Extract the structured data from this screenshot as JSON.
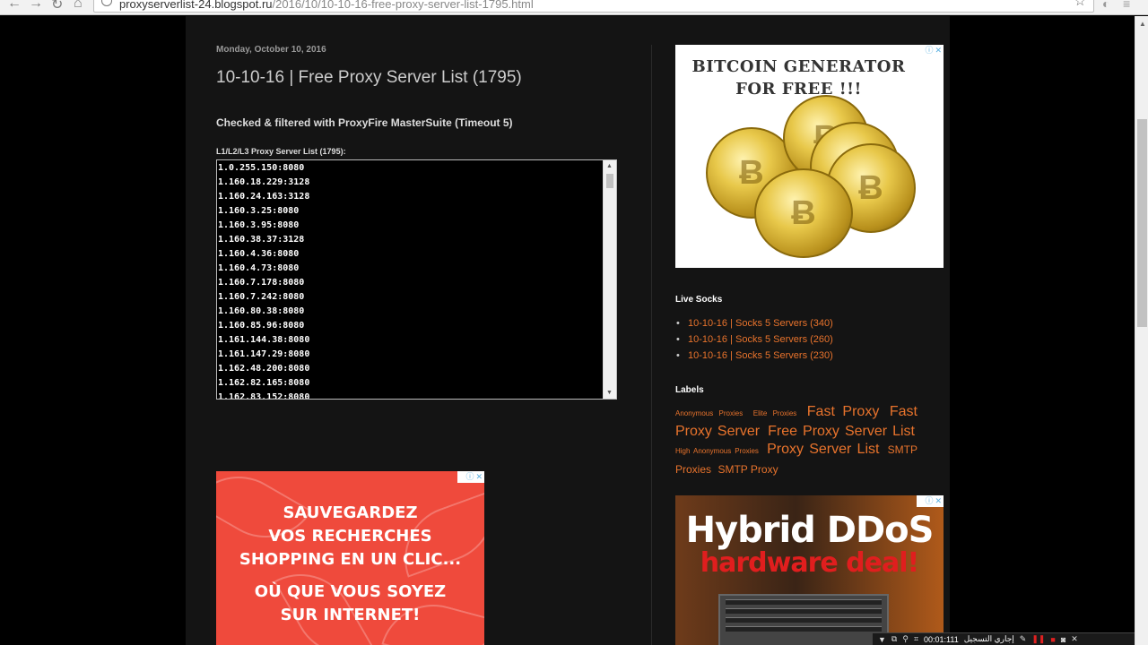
{
  "browser": {
    "url_host": "proxyserverlist-24.blogspot.ru",
    "url_path": "/2016/10/10-10-16-free-proxy-server-list-1795.html",
    "back_icon": "arrow-left-icon",
    "forward_icon": "arrow-right-icon",
    "reload_icon": "reload-icon",
    "home_icon": "home-icon",
    "star_icon": "star-icon"
  },
  "post": {
    "date": "Monday, October 10, 2016",
    "title": "10-10-16 | Free Proxy Server List (1795)",
    "subtitle": "Checked & filtered with ProxyFire MasterSuite (Timeout 5)",
    "list_label": "L1/L2/L3 Proxy Server List (1795):",
    "proxies": [
      "1.0.255.150:8080",
      "1.160.18.229:3128",
      "1.160.24.163:3128",
      "1.160.3.25:8080",
      "1.160.3.95:8080",
      "1.160.38.37:3128",
      "1.160.4.36:8080",
      "1.160.4.73:8080",
      "1.160.7.178:8080",
      "1.160.7.242:8080",
      "1.160.80.38:8080",
      "1.160.85.96:8080",
      "1.161.144.38:8080",
      "1.161.147.29:8080",
      "1.162.48.200:8080",
      "1.162.82.165:8080",
      "1.162.83.152:8080"
    ]
  },
  "ads": {
    "left_ad_lines": [
      "SAUVEGARDEZ",
      "VOS RECHERCHES",
      "SHOPPING EN UN CLIC...",
      "OÙ QUE VOUS SOYEZ",
      "SUR INTERNET!"
    ],
    "bitcoin_line1": "BITCOIN GENERATOR",
    "bitcoin_line2": "FOR FREE !!!",
    "ddos_line1": "Hybrid DDoS",
    "ddos_line2": "hardware deal!",
    "adchoices_icon": "adchoices-icon",
    "close_icon": "close-icon"
  },
  "sidebar": {
    "live_socks_heading": "Live Socks",
    "socks_links": [
      "10-10-16 | Socks 5 Servers (340)",
      "10-10-16 | Socks 5 Servers (260)",
      "10-10-16 | Socks 5 Servers (230)"
    ],
    "labels_heading": "Labels",
    "labels": [
      {
        "text": "Anonymous Proxies",
        "size": "s"
      },
      {
        "text": "Elite Proxies",
        "size": "s"
      },
      {
        "text": "Fast Proxy",
        "size": "l"
      },
      {
        "text": "Fast Proxy Server",
        "size": "l"
      },
      {
        "text": "Free Proxy Server List",
        "size": "l"
      },
      {
        "text": "High Anonymous Proxies",
        "size": "s"
      },
      {
        "text": "Proxy Server List",
        "size": "l"
      },
      {
        "text": "SMTP Proxies",
        "size": "m"
      },
      {
        "text": "SMTP Proxy",
        "size": "m"
      }
    ]
  },
  "taskbar": {
    "timer": "00:01:111",
    "recording_label": "إجاري التسجيل"
  },
  "colors": {
    "page_bg": "#000000",
    "content_bg": "#141414",
    "link": "#e8732c",
    "left_ad": "#ef4a3c"
  }
}
